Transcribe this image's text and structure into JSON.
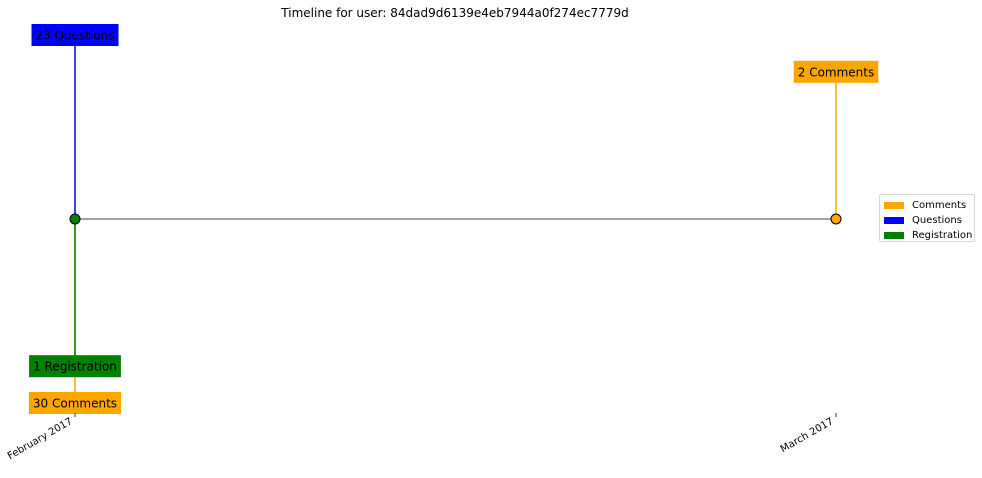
{
  "chart_data": {
    "type": "timeline",
    "title": "Timeline for user: 84dad9d6139e4eb7944a0f274ec7779d",
    "x_ticks": [
      "February 2017",
      "March 2017"
    ],
    "colors": {
      "Comments": "#ffa500",
      "Questions": "#0000ff",
      "Registration": "#008000",
      "baseline": "#808080"
    },
    "events": [
      {
        "date": "February 2017",
        "category": "Questions",
        "count": 23,
        "label": "23 Questions",
        "direction": "up",
        "level": 1.0
      },
      {
        "date": "February 2017",
        "category": "Registration",
        "count": 1,
        "label": "1 Registration",
        "direction": "down",
        "level": 0.8
      },
      {
        "date": "February 2017",
        "category": "Comments",
        "count": 30,
        "label": "30 Comments",
        "direction": "down",
        "level": 1.0
      },
      {
        "date": "March 2017",
        "category": "Comments",
        "count": 2,
        "label": "2 Comments",
        "direction": "up",
        "level": 0.8
      }
    ],
    "markers": [
      {
        "date": "February 2017",
        "category": "Registration"
      },
      {
        "date": "March 2017",
        "category": "Comments"
      }
    ],
    "legend": {
      "placement": "right",
      "entries": [
        "Comments",
        "Questions",
        "Registration"
      ]
    }
  }
}
